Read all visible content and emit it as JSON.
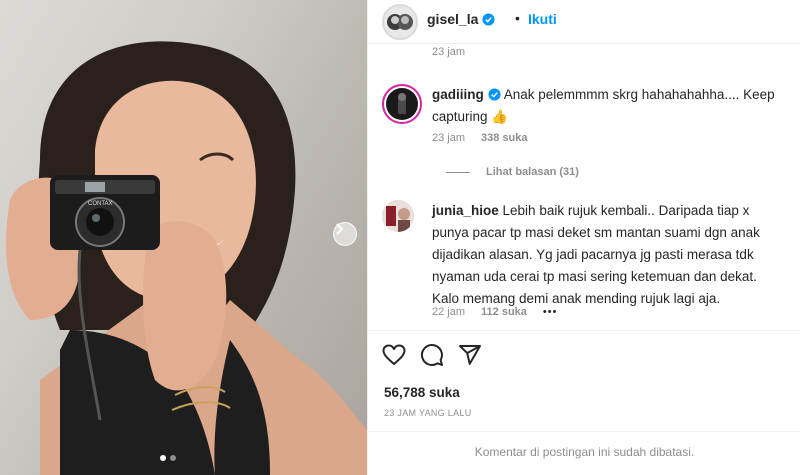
{
  "post": {
    "carousel_dots": 2,
    "active_dot": 1
  },
  "header": {
    "username": "gisel_la",
    "separator": "•",
    "follow_label": "Ikuti"
  },
  "comments": {
    "previous_time": "23 jam",
    "items": [
      {
        "username": "gadiiing",
        "verified": true,
        "text": "Anak pelemmmm skrg hahahahahha.... Keep capturing 👍",
        "time": "23 jam",
        "likes": "338 suka"
      },
      {
        "username": "junia_hioe",
        "verified": false,
        "text": "Lebih baik rujuk kembali.. Daripada tiap x punya pacar tp masi deket sm mantan suami dgn anak dijadikan alasan. Yg jadi pacarnya jg pasti merasa tdk nyaman uda cerai tp masi sering ketemuan dan dekat. Kalo memang demi anak mending rujuk lagi aja.",
        "time": "22 jam",
        "likes": "112 suka",
        "more": "•••"
      }
    ],
    "view_replies": "Lihat balasan (31)"
  },
  "actions": {
    "like_icon": "heart-icon",
    "comment_icon": "comment-icon",
    "share_icon": "share-icon",
    "likes_count": "56,788 suka",
    "posted_time": "23 JAM YANG LALU",
    "comments_disabled": "Komentar di postingan ini sudah dibatasi."
  },
  "colors": {
    "link_blue": "#0095f6",
    "verified_blue": "#0095f6",
    "muted": "#8e8e8e",
    "text": "#262626"
  }
}
